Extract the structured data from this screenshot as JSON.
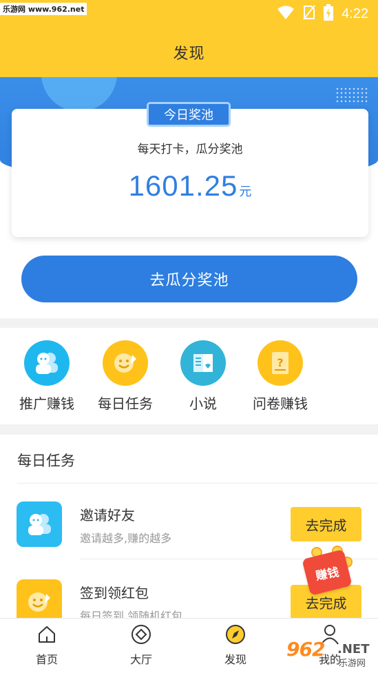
{
  "status_bar": {
    "watermark": "乐游网 www.962.net",
    "time": "4:22"
  },
  "header": {
    "title": "发现"
  },
  "pool": {
    "badge": "今日奖池",
    "subtitle": "每天打卡，瓜分奖池",
    "amount": "1601.25",
    "unit": "元",
    "button": "去瓜分奖池"
  },
  "features": [
    {
      "label": "推广赚钱",
      "icon": "promote-icon",
      "color": "#1fb8ee"
    },
    {
      "label": "每日任务",
      "icon": "smile-icon",
      "color": "#ffc21a"
    },
    {
      "label": "小说",
      "icon": "book-icon",
      "color": "#32b4d8"
    },
    {
      "label": "问卷赚钱",
      "icon": "survey-icon",
      "color": "#ffc21a"
    }
  ],
  "tasks": {
    "title": "每日任务",
    "items": [
      {
        "title": "邀请好友",
        "desc": "邀请越多,赚的越多",
        "button": "去完成",
        "icon": "invite-icon",
        "color": "#2bbcf2"
      },
      {
        "title": "签到领红包",
        "desc": "每日签到 领随机红包",
        "button": "去完成",
        "icon": "smile-icon",
        "color": "#ffc21a"
      }
    ]
  },
  "float_badge": {
    "label": "赚钱"
  },
  "tabbar": [
    {
      "label": "首页",
      "icon": "home-icon"
    },
    {
      "label": "大厅",
      "icon": "hall-icon"
    },
    {
      "label": "发现",
      "icon": "compass-icon"
    },
    {
      "label": "我的",
      "icon": "user-icon"
    }
  ],
  "watermark": {
    "num": "962",
    "net": ".NET",
    "cn": "乐游网"
  }
}
